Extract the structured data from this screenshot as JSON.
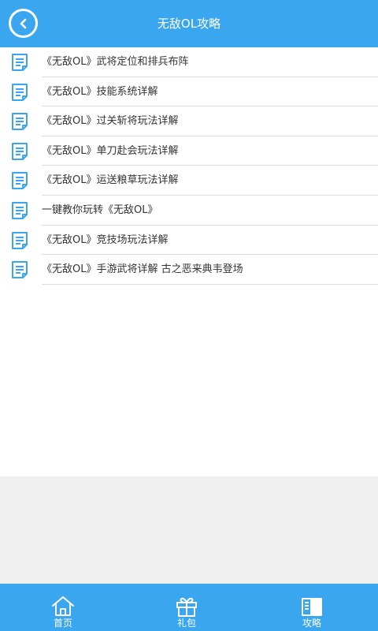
{
  "header": {
    "title": "无敌OL攻略",
    "back_icon": "chevron-left-icon"
  },
  "list": [
    {
      "title": "《无敌OL》武将定位和排兵布阵",
      "icon": "document-icon"
    },
    {
      "title": "《无敌OL》技能系统详解",
      "icon": "document-icon"
    },
    {
      "title": "《无敌OL》过关斩将玩法详解",
      "icon": "document-icon"
    },
    {
      "title": "《无敌OL》单刀赴会玩法详解",
      "icon": "document-icon"
    },
    {
      "title": "《无敌OL》运送粮草玩法详解",
      "icon": "document-icon"
    },
    {
      "title": "一键教你玩转《无敌OL》",
      "icon": "document-icon"
    },
    {
      "title": "《无敌OL》竞技场玩法详解",
      "icon": "document-icon"
    },
    {
      "title": "《无敌OL》手游武将详解 古之恶来典韦登场",
      "icon": "document-icon"
    }
  ],
  "tabbar": [
    {
      "label": "首页",
      "icon": "home-icon"
    },
    {
      "label": "礼包",
      "icon": "gift-icon"
    },
    {
      "label": "攻略",
      "icon": "book-icon"
    }
  ],
  "colors": {
    "accent": "#3aa6f0",
    "text": "#333333",
    "divider": "#dcdcdc",
    "empty_area": "#f0f0f0"
  }
}
